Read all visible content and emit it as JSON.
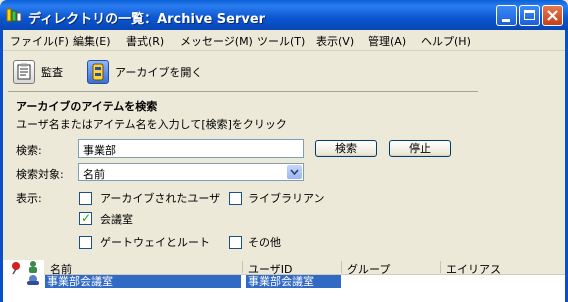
{
  "window": {
    "title": "ディレクトリの一覧：Archive Server"
  },
  "menu": [
    {
      "label": "ファイル(F)"
    },
    {
      "label": "編集(E)"
    },
    {
      "label": "書式(R)"
    },
    {
      "label": "メッセージ(M)"
    },
    {
      "label": "ツール(T)"
    },
    {
      "label": "表示(V)"
    },
    {
      "label": "管理(A)"
    },
    {
      "label": "ヘルプ(H)"
    }
  ],
  "toolbar": {
    "audit_label": "監査",
    "open_archive_label": "アーカイブを開く"
  },
  "search": {
    "heading": "アーカイブのアイテムを検索",
    "instructions": "ユーザ名またはアイテム名を入力して[検索]をクリック",
    "query_label": "検索:",
    "query_value": "事業部",
    "search_button": "検索",
    "stop_button": "停止",
    "target_label": "検索対象:",
    "target_value": "名前",
    "display_label": "表示:",
    "options": [
      {
        "label": "アーカイブされたユーザ",
        "checked": false
      },
      {
        "label": "ライブラリアン",
        "checked": false
      },
      {
        "label": "会議室",
        "checked": true
      },
      {
        "label": "ゲートウェイとルート",
        "checked": false
      },
      {
        "label": "その他",
        "checked": false
      }
    ]
  },
  "results": {
    "columns": [
      "名前",
      "ユーザID",
      "グループ",
      "エイリアス"
    ],
    "rows": [
      {
        "name": "事業部会議室",
        "userid": "事業部会議室",
        "group": "",
        "alias": ""
      }
    ]
  }
}
